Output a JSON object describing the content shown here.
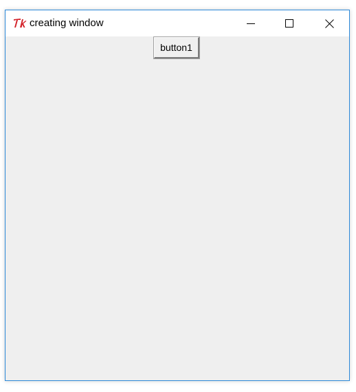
{
  "window": {
    "title": "creating window",
    "app_icon": "tk-feather-icon",
    "controls": {
      "minimize_icon": "minimize-icon",
      "maximize_icon": "maximize-icon",
      "close_icon": "close-icon"
    },
    "accent_color": "#2b88d8",
    "client_background": "#efefef"
  },
  "content": {
    "button1_label": "button1"
  }
}
